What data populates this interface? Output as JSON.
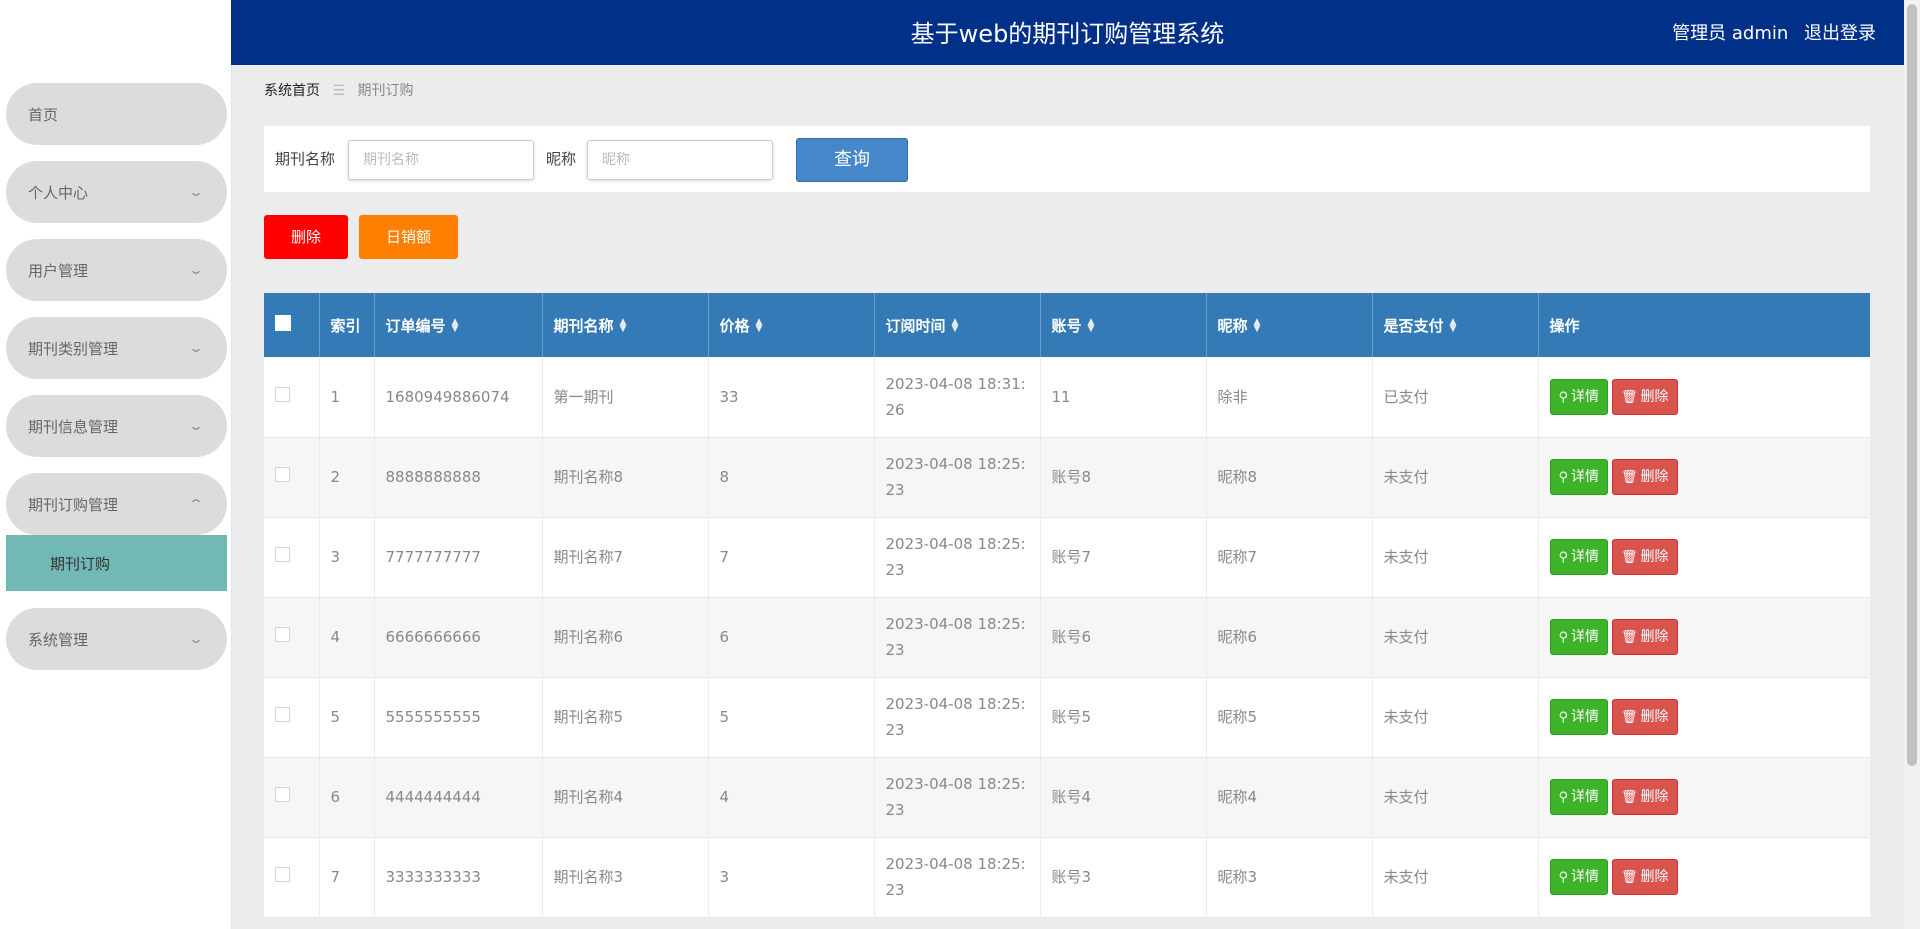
{
  "header": {
    "title": "基于web的期刊订购管理系统",
    "user_label": "管理员 admin",
    "logout": "退出登录"
  },
  "sidebar": {
    "items": [
      {
        "label": "首页",
        "chevron": ""
      },
      {
        "label": "个人中心",
        "chevron": "⌄"
      },
      {
        "label": "用户管理",
        "chevron": "⌄"
      },
      {
        "label": "期刊类别管理",
        "chevron": "⌄"
      },
      {
        "label": "期刊信息管理",
        "chevron": "⌄"
      },
      {
        "label": "期刊订购管理",
        "chevron": "⌃"
      },
      {
        "label": "系统管理",
        "chevron": "⌄"
      }
    ],
    "sub_active": "期刊订购"
  },
  "breadcrumb": {
    "home": "系统首页",
    "sep": "☰",
    "current": "期刊订购"
  },
  "search": {
    "name_label": "期刊名称",
    "name_placeholder": "期刊名称",
    "nick_label": "昵称",
    "nick_placeholder": "昵称",
    "query": "查询"
  },
  "actions": {
    "delete": "删除",
    "daily_sales": "日销额"
  },
  "table": {
    "headers": [
      "索引",
      "订单编号",
      "期刊名称",
      "价格",
      "订阅时间",
      "账号",
      "昵称",
      "是否支付",
      "操作"
    ],
    "sortable": [
      false,
      true,
      true,
      true,
      true,
      true,
      true,
      true,
      false
    ],
    "detail_label": "详情",
    "delete_label": "删除",
    "rows": [
      {
        "idx": "1",
        "order": "1680949886074",
        "name": "第一期刊",
        "price": "33",
        "time": "2023-04-08 18:31:26",
        "account": "11",
        "nick": "除非",
        "paid": "已支付"
      },
      {
        "idx": "2",
        "order": "8888888888",
        "name": "期刊名称8",
        "price": "8",
        "time": "2023-04-08 18:25:23",
        "account": "账号8",
        "nick": "昵称8",
        "paid": "未支付"
      },
      {
        "idx": "3",
        "order": "7777777777",
        "name": "期刊名称7",
        "price": "7",
        "time": "2023-04-08 18:25:23",
        "account": "账号7",
        "nick": "昵称7",
        "paid": "未支付"
      },
      {
        "idx": "4",
        "order": "6666666666",
        "name": "期刊名称6",
        "price": "6",
        "time": "2023-04-08 18:25:23",
        "account": "账号6",
        "nick": "昵称6",
        "paid": "未支付"
      },
      {
        "idx": "5",
        "order": "5555555555",
        "name": "期刊名称5",
        "price": "5",
        "time": "2023-04-08 18:25:23",
        "account": "账号5",
        "nick": "昵称5",
        "paid": "未支付"
      },
      {
        "idx": "6",
        "order": "4444444444",
        "name": "期刊名称4",
        "price": "4",
        "time": "2023-04-08 18:25:23",
        "account": "账号4",
        "nick": "昵称4",
        "paid": "未支付"
      },
      {
        "idx": "7",
        "order": "3333333333",
        "name": "期刊名称3",
        "price": "3",
        "time": "2023-04-08 18:25:23",
        "account": "账号3",
        "nick": "昵称3",
        "paid": "未支付"
      }
    ]
  },
  "colors": {
    "header_bg": "#003087",
    "table_head_bg": "#337ab7",
    "menu_bg": "#dcdcdc",
    "submenu_active_bg": "#72b8b5",
    "query_btn": "#4587c9",
    "delete_btn": "#ff0000",
    "sales_btn": "#ff7f00",
    "detail_btn": "#3db32a",
    "row_delete_btn": "#d9534f"
  },
  "icons": [
    "search-icon",
    "trash-icon",
    "chevron-down-icon",
    "chevron-up-icon",
    "sort-icon"
  ]
}
